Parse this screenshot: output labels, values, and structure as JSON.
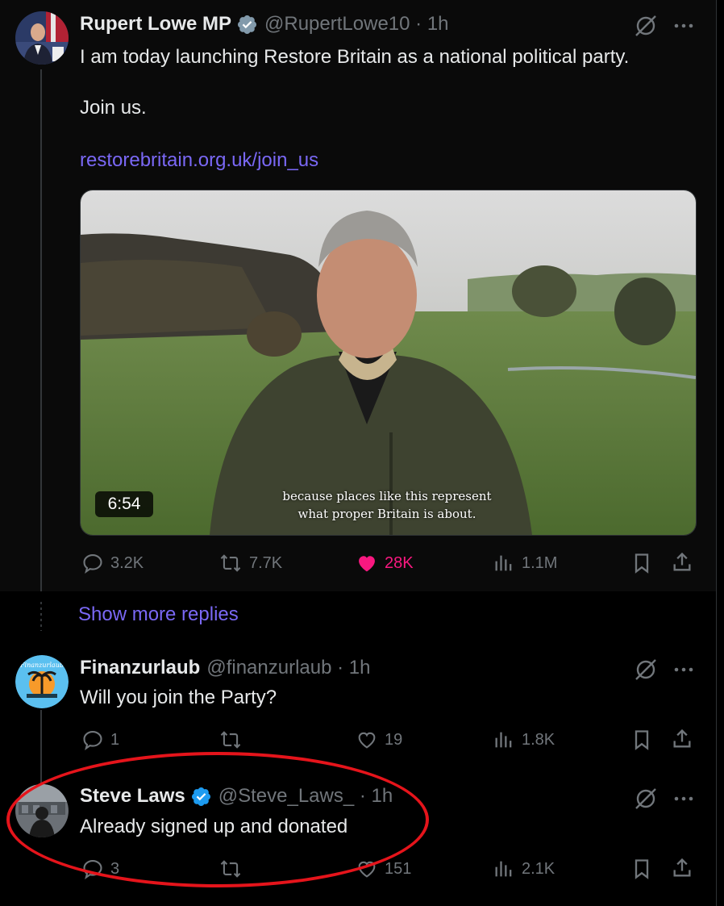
{
  "main_tweet": {
    "name": "Rupert Lowe MP",
    "handle": "@RupertLowe10 · 1h",
    "line1": "I am today launching Restore Britain as a national political party.",
    "line2": "Join us.",
    "link": "restorebritain.org.uk/join_us",
    "video_duration": "6:54",
    "caption_line1": "because places like this represent",
    "caption_line2": "what proper Britain is about.",
    "actions": {
      "replies": "3.2K",
      "reposts": "7.7K",
      "likes": "28K",
      "views": "1.1M"
    }
  },
  "show_more": "Show more replies",
  "reply1": {
    "name": "Finanzurlaub",
    "handle": "@finanzurlaub · 1h",
    "text": "Will you join the Party?",
    "actions": {
      "replies": "1",
      "reposts": "",
      "likes": "19",
      "views": "1.8K"
    }
  },
  "reply2": {
    "name": "Steve Laws",
    "handle": "@Steve_Laws_ · 1h",
    "text": "Already signed up and donated",
    "actions": {
      "replies": "3",
      "reposts": "",
      "likes": "151",
      "views": "2.1K"
    }
  },
  "icons": {
    "verified": "verified-badge-icon",
    "grok": "grok-slash-icon",
    "more": "more-dots-icon",
    "reply": "reply-bubble-icon",
    "repost": "repost-arrows-icon",
    "like": "heart-icon",
    "views": "views-bars-icon",
    "bookmark": "bookmark-icon",
    "share": "share-icon"
  },
  "colors": {
    "link": "#7a68f5",
    "like": "#f91880",
    "verified": "#1d9bf0",
    "highlight": "#e5141b"
  }
}
